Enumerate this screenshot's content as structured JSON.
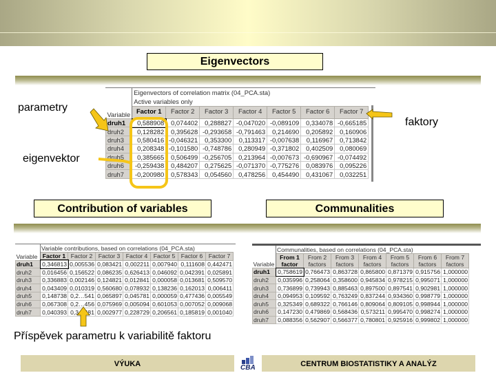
{
  "slide": {
    "main_title": "Eigenvectors",
    "section_left_title": "Contribution of variables",
    "section_right_title": "Communalities",
    "annotations": {
      "parametry": "parametry",
      "faktory": "faktory",
      "eigenvektor": "eigenvektor",
      "contribution_note": "Příspěvek parametru k variabilitě faktoru"
    },
    "colors": {
      "highlight": "#f5c518",
      "title_box": "#fffdcc",
      "footer": "#ddd6ae"
    }
  },
  "eigen_table": {
    "caption1": "Eigenvectors of correlation matrix (04_PCA.sta)",
    "caption2": "Active variables only",
    "var_header": "Variable",
    "columns": [
      "Factor 1",
      "Factor 2",
      "Factor 3",
      "Factor 4",
      "Factor 5",
      "Factor 6",
      "Factor 7"
    ],
    "rows": [
      {
        "name": "druh1",
        "values": [
          "0,588908",
          "0,074402",
          "0,288827",
          "-0,047020",
          "-0,089109",
          "0,334078",
          "-0,665185"
        ]
      },
      {
        "name": "druh2",
        "values": [
          "0,128282",
          "0,395628",
          "-0,293658",
          "-0,791463",
          "0,214690",
          "0,205892",
          "0,160906"
        ]
      },
      {
        "name": "druh3",
        "values": [
          "0,580416",
          "-0,046321",
          "0,353300",
          "0,113317",
          "-0,007638",
          "0,116967",
          "0,713842"
        ]
      },
      {
        "name": "druh4",
        "values": [
          "0,208348",
          "-0,101580",
          "-0,748786",
          "0,280949",
          "-0,371802",
          "0,402509",
          "0,080069"
        ]
      },
      {
        "name": "druh5",
        "values": [
          "0,385665",
          "0,506499",
          "-0,256705",
          "0,213964",
          "-0,007673",
          "-0,690967",
          "-0,074492"
        ]
      },
      {
        "name": "druh6",
        "values": [
          "-0,259438",
          "0,484207",
          "0,275625",
          "-0,071370",
          "-0,775276",
          "0,083976",
          "0,095226"
        ]
      },
      {
        "name": "druh7",
        "values": [
          "-0,200980",
          "0,578343",
          "0,054560",
          "0,478256",
          "0,454490",
          "0,431067",
          "0,032251"
        ]
      }
    ]
  },
  "contrib_table": {
    "caption": "Variable contributions, based on correlations (04_PCA.sta)",
    "var_header": "Variable",
    "columns": [
      "Factor 1",
      "Factor 2",
      "Factor 3",
      "Factor 4",
      "Factor 5",
      "Factor 6",
      "Factor 7"
    ],
    "rows": [
      {
        "name": "druh1",
        "values": [
          "0,346813",
          "0,005536",
          "0,083421",
          "0,002211",
          "0,007940",
          "0,111608",
          "0,442471"
        ]
      },
      {
        "name": "druh2",
        "values": [
          "0,016456",
          "0,156522",
          "0,086235",
          "0,626413",
          "0,046092",
          "0,042391",
          "0,025891"
        ]
      },
      {
        "name": "druh3",
        "values": [
          "0,336883",
          "0,002146",
          "0,124821",
          "0,012841",
          "0,000058",
          "0,013681",
          "0,509570"
        ]
      },
      {
        "name": "druh4",
        "values": [
          "0,043409",
          "0,010319",
          "0,560680",
          "0,078932",
          "0,138236",
          "0,162013",
          "0,006411"
        ]
      },
      {
        "name": "druh5",
        "values": [
          "0,148738",
          "0,2…541",
          "0,065897",
          "0,045781",
          "0,000059",
          "0,477436",
          "0,005549"
        ]
      },
      {
        "name": "druh6",
        "values": [
          "0,067308",
          "0,2…456",
          "0,075969",
          "0,005094",
          "0,601053",
          "0,007052",
          "0,009068"
        ]
      },
      {
        "name": "druh7",
        "values": [
          "0,040393",
          "0,3…481",
          "0,002977",
          "0,228729",
          "0,206561",
          "0,185819",
          "0,001040"
        ]
      }
    ]
  },
  "commun_table": {
    "caption": "Communalities, based on correlations (04_PCA.sta)",
    "var_header": "Variable",
    "columns": [
      [
        "From 1",
        "factor"
      ],
      [
        "From 2",
        "factors"
      ],
      [
        "From 3",
        "factors"
      ],
      [
        "From 4",
        "factors"
      ],
      [
        "From 5",
        "factors"
      ],
      [
        "From 6",
        "factors"
      ],
      [
        "From 7",
        "factors"
      ]
    ],
    "rows": [
      {
        "name": "druh1",
        "values": [
          "0,758619",
          "0,766473",
          "0,863728",
          "0,865800",
          "0,871379",
          "0,915756",
          "1,000000"
        ]
      },
      {
        "name": "druh2",
        "values": [
          "0,035996",
          "0,258064",
          "0,358600",
          "0,945834",
          "0,978215",
          "0,995071",
          "1,000000"
        ]
      },
      {
        "name": "druh3",
        "values": [
          "0,736899",
          "0,739943",
          "0,885463",
          "0,897500",
          "0,897541",
          "0,902981",
          "1,000000"
        ]
      },
      {
        "name": "druh4",
        "values": [
          "0,094953",
          "0,109592",
          "0,763249",
          "0,837244",
          "0,934360",
          "0,998779",
          "1,000000"
        ]
      },
      {
        "name": "druh5",
        "values": [
          "0,325349",
          "0,689322",
          "0,766146",
          "0,809064",
          "0,809105",
          "0,998944",
          "1,000000"
        ]
      },
      {
        "name": "druh6",
        "values": [
          "0,147230",
          "0,479869",
          "0,568436",
          "0,573211",
          "0,995470",
          "0,998274",
          "1,000000"
        ]
      },
      {
        "name": "druh7",
        "values": [
          "0,088356",
          "0,562907",
          "0,566377",
          "0,780801",
          "0,925916",
          "0,999802",
          "1,000000"
        ]
      }
    ]
  },
  "footer": {
    "left_label": "VÝUKA",
    "logo_text": "CBA",
    "right_label": "CENTRUM BIOSTATISTIKY A ANALÝZ"
  }
}
